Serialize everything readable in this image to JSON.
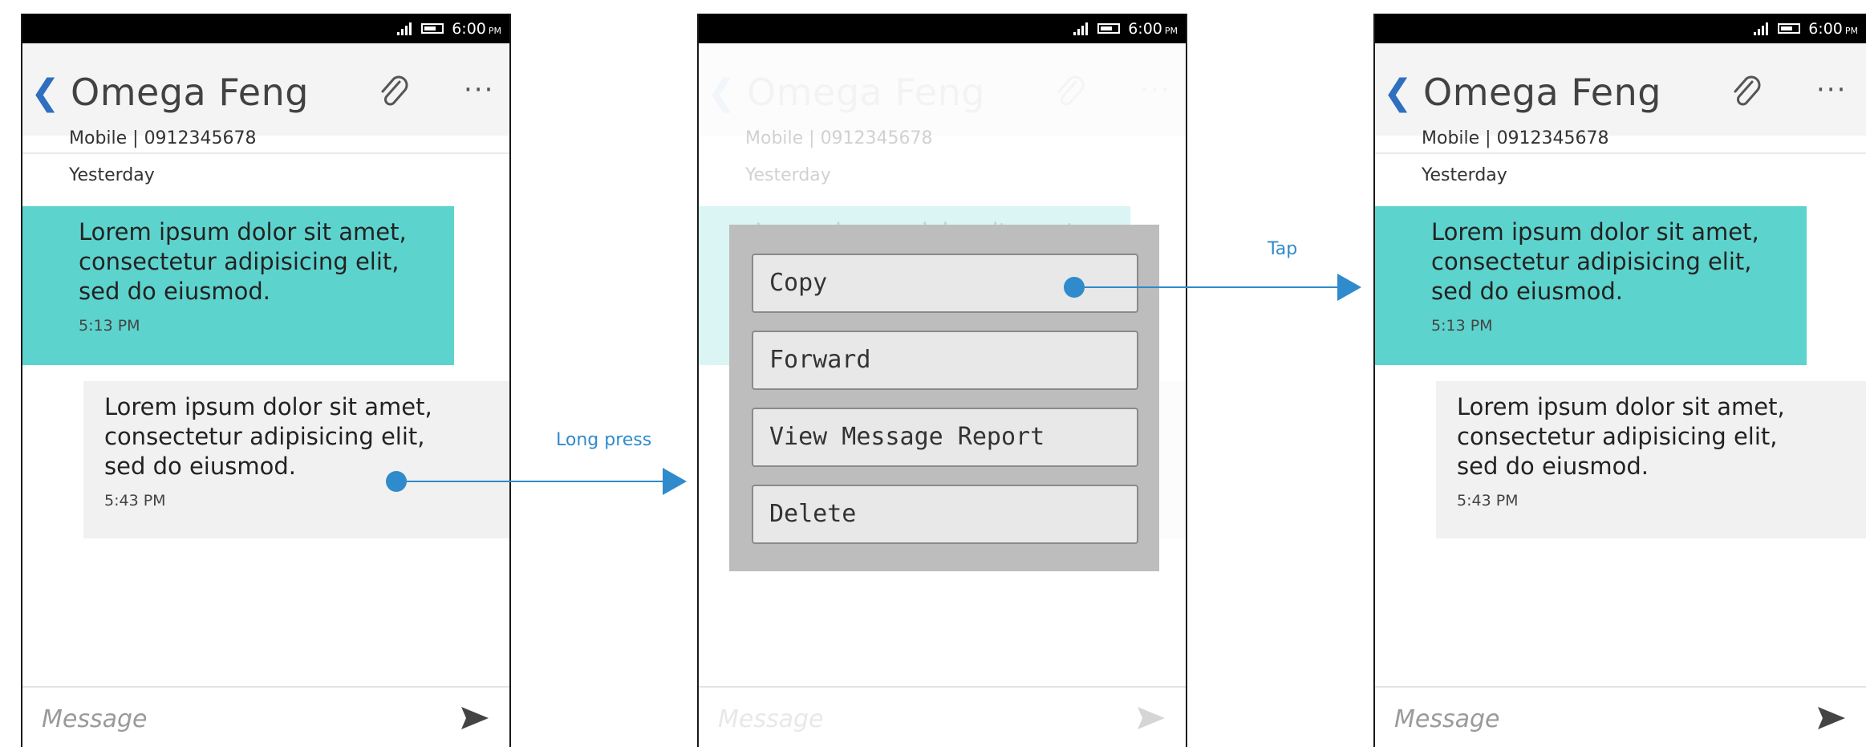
{
  "colors": {
    "sent_bubble": "#5dd3cd",
    "received_bubble": "#f1f1f1",
    "accent": "#2f8bcb",
    "back_arrow": "#2f6fbf"
  },
  "status_bar": {
    "time": "6:00",
    "ampm": "PM"
  },
  "conversation": {
    "contact_name": "Omega Feng",
    "contact_info": "Mobile | 0912345678",
    "date_label": "Yesterday",
    "messages": [
      {
        "direction": "sent",
        "text": "Lorem ipsum dolor sit amet,\nconsectetur adipisicing elit,\nsed do eiusmod.",
        "time": "5:13 PM"
      },
      {
        "direction": "received",
        "text": "Lorem ipsum dolor sit amet,\nconsectetur adipisicing elit,\nsed do eiusmod.",
        "time": "5:43 PM"
      }
    ],
    "composer_placeholder": "Message"
  },
  "icons": {
    "back": "chevron-left-icon",
    "attach": "paperclip-icon",
    "more": "more-dots-icon",
    "send": "send-icon"
  },
  "context_menu": {
    "items": [
      "Copy",
      "Forward",
      "View Message Report",
      "Delete"
    ]
  },
  "gestures": {
    "long_press_label": "Long press",
    "tap_label": "Tap"
  }
}
